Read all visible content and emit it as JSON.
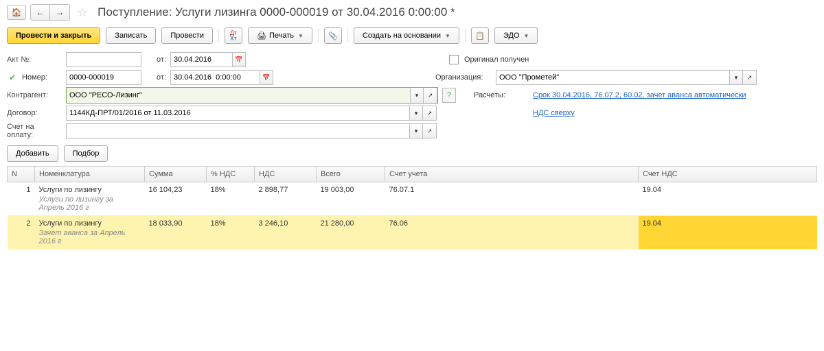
{
  "title": "Поступление: Услуги лизинга 0000-000019 от 30.04.2016 0:00:00 *",
  "toolbar": {
    "post_close": "Провести и закрыть",
    "save": "Записать",
    "post": "Провести",
    "print": "Печать",
    "create_based": "Создать на основании",
    "edo": "ЭДО"
  },
  "form": {
    "act_label": "Акт №:",
    "act_no": "",
    "from_label": "от:",
    "act_date": "30.04.2016",
    "original_label": "Оригинал получен",
    "number_label": "Номер:",
    "number": "0000-000019",
    "doc_date": "30.04.2016  0:00:00",
    "org_label": "Организация:",
    "org": "ООО \"Прометей\"",
    "contragent_label": "Контрагент:",
    "contragent": "ООО \"РЕСО-Лизинг\"",
    "calc_label": "Расчеты:",
    "calc_link": "Срок 30.04.2016, 76.07.2, 60.02, зачет аванса автоматически",
    "contract_label": "Договор:",
    "contract": "1144КД-ПРТ/01/2016 от 11.03.2016",
    "vat_link": "НДС сверху",
    "invoice_label": "Счет на оплату:",
    "invoice": ""
  },
  "grid": {
    "add": "Добавить",
    "select": "Подбор",
    "cols": {
      "n": "N",
      "nomenclature": "Номенклатура",
      "sum": "Сумма",
      "vat_pct": "% НДС",
      "vat": "НДС",
      "total": "Всего",
      "account": "Счет учета",
      "vat_acc": "Счет НДС"
    },
    "rows": [
      {
        "n": "1",
        "nom": "Услуги по лизингу",
        "sub": "Услуги по лизингу  за Апрель 2016 г",
        "sum": "16 104,23",
        "vat_pct": "18%",
        "vat": "2 898,77",
        "total": "19 003,00",
        "account": "76.07.1",
        "vat_acc": "19.04"
      },
      {
        "n": "2",
        "nom": "Услуги по лизингу",
        "sub": "Зачет аванса за Апрель 2016 г",
        "sum": "18 033,90",
        "vat_pct": "18%",
        "vat": "3 246,10",
        "total": "21 280,00",
        "account": "76.06",
        "vat_acc": "19.04"
      }
    ]
  }
}
